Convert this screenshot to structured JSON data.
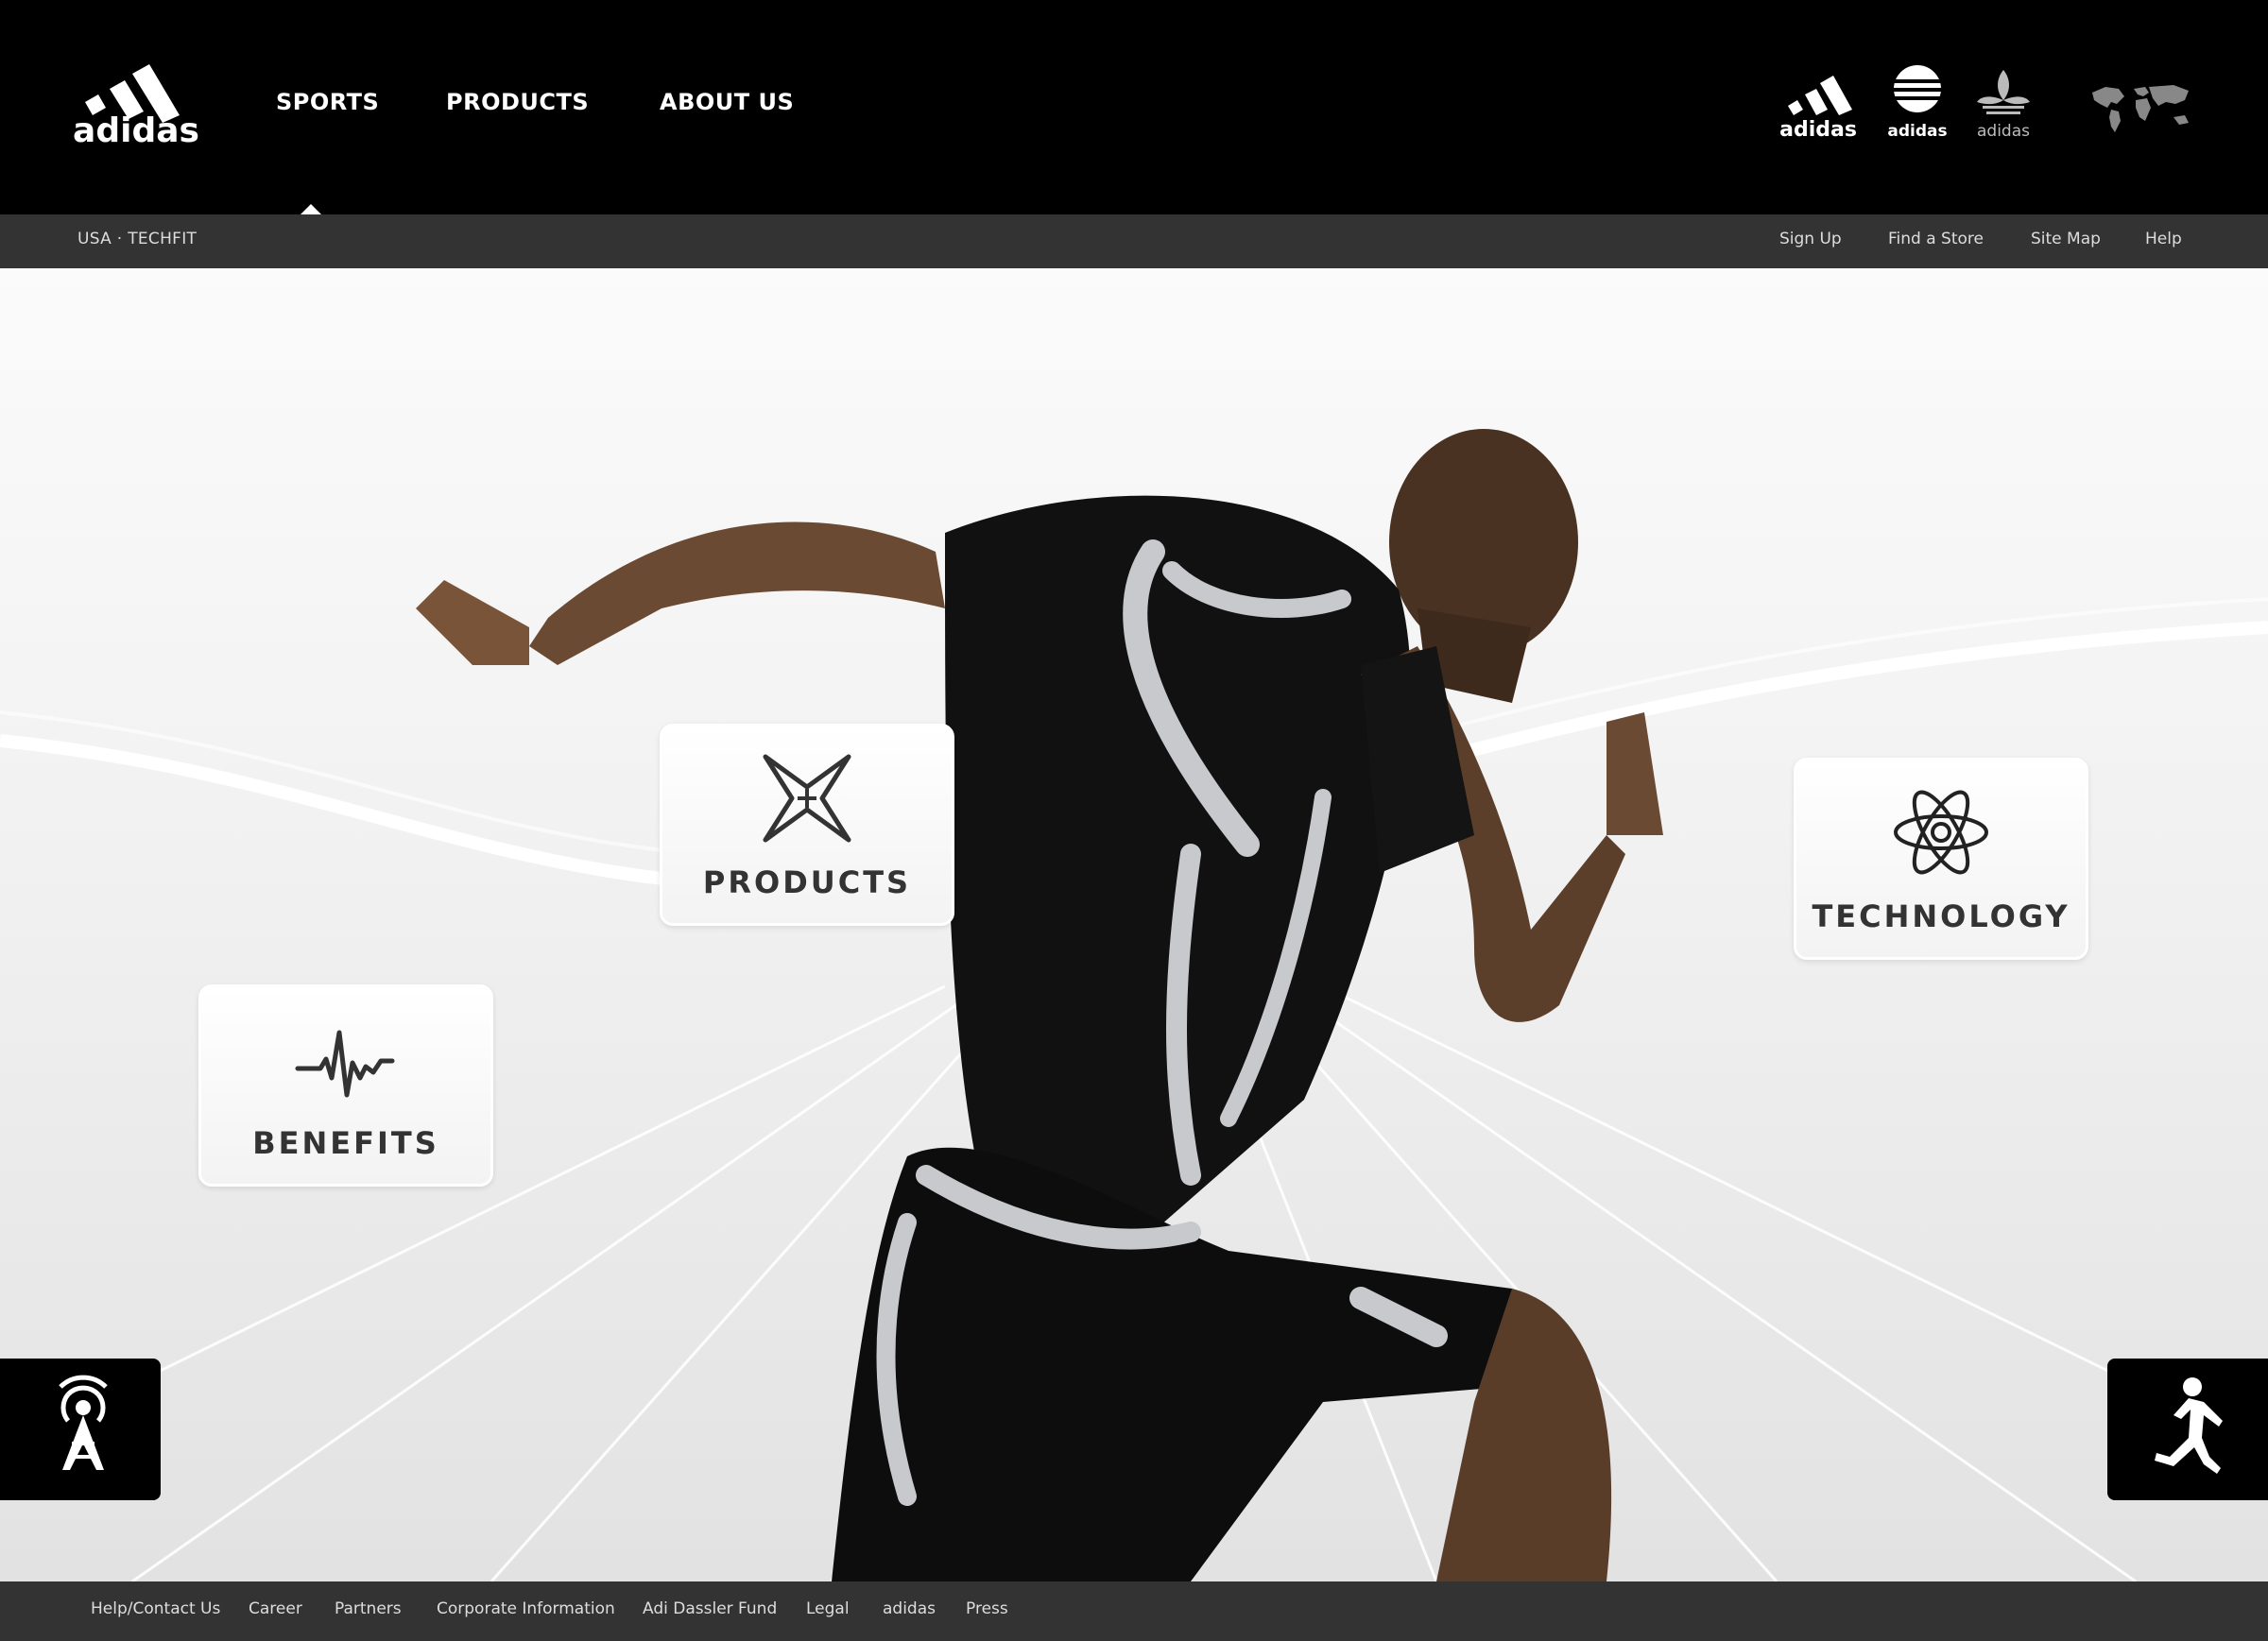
{
  "header": {
    "logo_text": "adidas",
    "nav": [
      {
        "label": "SPORTS"
      },
      {
        "label": "PRODUCTS"
      },
      {
        "label": "ABOUT US"
      }
    ],
    "brand_marks": [
      "adidas",
      "adidas",
      "adidas"
    ],
    "world_icon": "world-map-icon"
  },
  "subbar": {
    "breadcrumb": "USA · TECHFIT",
    "links": [
      "Sign Up",
      "Find a Store",
      "Site Map",
      "Help"
    ]
  },
  "hero": {
    "tiles": [
      {
        "label": "PRODUCTS",
        "icon": "star-x-icon"
      },
      {
        "label": "TECHNOLOGY",
        "icon": "atom-icon"
      },
      {
        "label": "BENEFITS",
        "icon": "heartbeat-icon"
      }
    ],
    "side_buttons": [
      {
        "icon": "broadcast-tower-icon"
      },
      {
        "icon": "runner-icon"
      }
    ]
  },
  "footer": {
    "links": [
      "Help/Contact Us",
      "Career",
      "Partners",
      "Corporate Information",
      "Adi Dassler Fund",
      "Legal",
      "adidas",
      "Press"
    ]
  },
  "colors": {
    "nav_bg": "#000000",
    "bar_bg": "#333333",
    "hero_bg": "#f1f1f1",
    "tile_text": "#333333"
  }
}
